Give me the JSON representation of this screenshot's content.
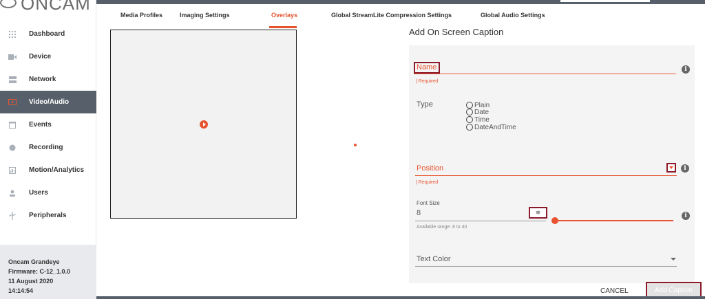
{
  "logo": {
    "text": "ONCAM"
  },
  "tabs": [
    {
      "label": "Media Profiles"
    },
    {
      "label": "Imaging Settings"
    },
    {
      "label": "Overlays"
    },
    {
      "label": "Global StreamLite Compression Settings"
    },
    {
      "label": "Global Audio Settings"
    }
  ],
  "sidebar": {
    "items": [
      {
        "label": "Dashboard",
        "icon": "dashboard-grid-icon"
      },
      {
        "label": "Device",
        "icon": "camera-icon"
      },
      {
        "label": "Network",
        "icon": "network-icon"
      },
      {
        "label": "Video/Audio",
        "icon": "video-icon",
        "active": true
      },
      {
        "label": "Events",
        "icon": "calendar-icon"
      },
      {
        "label": "Recording",
        "icon": "record-dot-icon"
      },
      {
        "label": "Motion/Analytics",
        "icon": "bar-chart-icon"
      },
      {
        "label": "Users",
        "icon": "user-icon"
      },
      {
        "label": "Peripherals",
        "icon": "usb-icon"
      }
    ],
    "footer": {
      "device": "Oncam Grandeye",
      "firmware": "Firmware: C-12_1.0.0",
      "date": "11 August 2020",
      "time": "14:14:54"
    }
  },
  "form": {
    "title": "Add On Screen Caption",
    "name_label": "Name",
    "name_required": "| Required",
    "type_label": "Type",
    "type_options": [
      "Plain",
      "Date",
      "Time",
      "DateAndTime"
    ],
    "position_label": "Position",
    "position_required": "| Required",
    "font_size_label": "Font Size",
    "font_size_value": "8",
    "stepper_glyph": "≑",
    "font_size_range": "Available range: 8 to 40",
    "text_color_label": "Text Color",
    "info_glyph": "i",
    "cancel_label": "CANCEL",
    "add_label": "Add Caption"
  },
  "colors": {
    "accent": "#e8532f",
    "dark_bar": "#57606a",
    "highlight_border": "#8b1a2a"
  }
}
